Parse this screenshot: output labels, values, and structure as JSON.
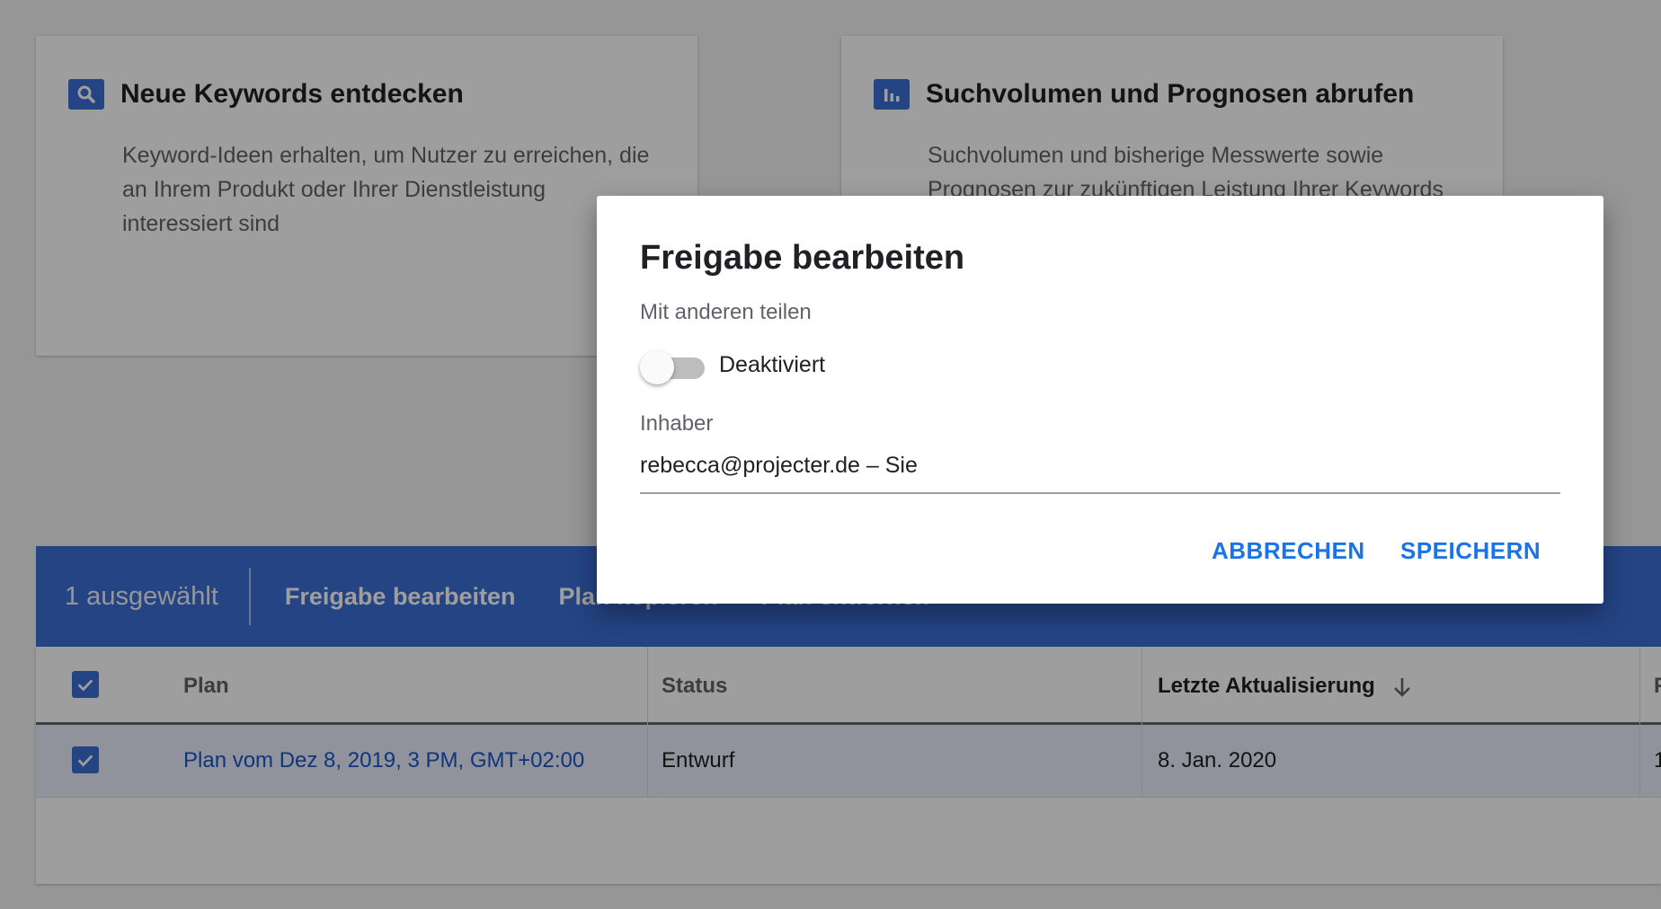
{
  "cards": [
    {
      "icon": "search-icon",
      "title": "Neue Keywords entdecken",
      "description": "Keyword-Ideen erhalten, um Nutzer zu erreichen, die an Ihrem Produkt oder Ihrer Dienstleistung interessiert sind"
    },
    {
      "icon": "bar-chart-icon",
      "title": "Suchvolumen und Prognosen abrufen",
      "description": "Suchvolumen und bisherige Messwerte sowie Prognosen zur zukünftigen Leistung Ihrer Keywords"
    }
  ],
  "selection_bar": {
    "count": "1 ausgewählt",
    "actions": [
      "Freigabe bearbeiten",
      "Plan kopieren",
      "Plan entfernen"
    ]
  },
  "table": {
    "headers": [
      "Plan",
      "Status",
      "Letzte Aktualisierung",
      "F"
    ],
    "sort_icon": "arrow-down-icon",
    "rows": [
      {
        "plan": "Plan vom Dez 8, 2019, 3 PM, GMT+02:00",
        "status": "Entwurf",
        "updated": "8. Jan. 2020",
        "extra": "1"
      }
    ]
  },
  "dialog": {
    "title": "Freigabe bearbeiten",
    "share_label": "Mit anderen teilen",
    "toggle_state": "Deaktiviert",
    "owner_label": "Inhaber",
    "owner_value": "rebecca@projecter.de – Sie",
    "cancel": "ABBRECHEN",
    "save": "SPEICHERN"
  },
  "colors": {
    "accent": "#3b6ed6",
    "link": "#1a56c9",
    "button": "#1a73e8"
  }
}
